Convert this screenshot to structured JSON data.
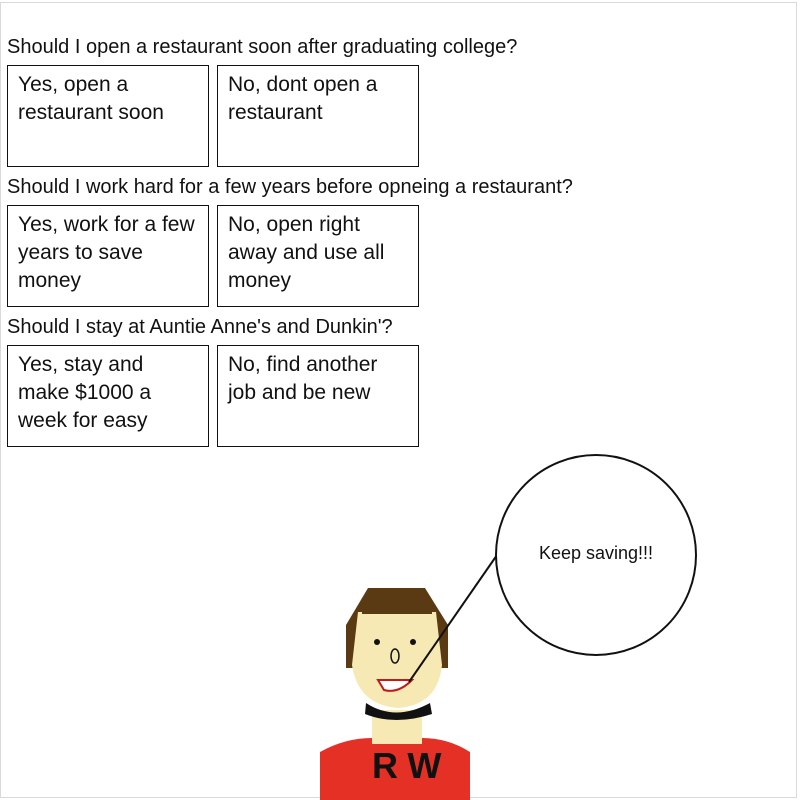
{
  "questions": [
    {
      "text": "Should I open a restaurant soon after graduating college?",
      "options": [
        "Yes, open a restaurant soon",
        "No, dont open a restaurant"
      ]
    },
    {
      "text": "Should I work hard for a few years before opneing a restaurant?",
      "options": [
        "Yes, work for a few years to save money",
        "No, open right away and use all money"
      ]
    },
    {
      "text": "Should I stay at Auntie Anne's and Dunkin'?",
      "options": [
        "Yes, stay and make $1000 a week for easy",
        "No, find another job and be new"
      ]
    }
  ],
  "character": {
    "speech": "Keep saving!!!",
    "shirt_letters": "RW",
    "colors": {
      "hair": "#5a3a12",
      "skin": "#f7e9b4",
      "shirt": "#e53025",
      "outline": "#111111"
    }
  }
}
